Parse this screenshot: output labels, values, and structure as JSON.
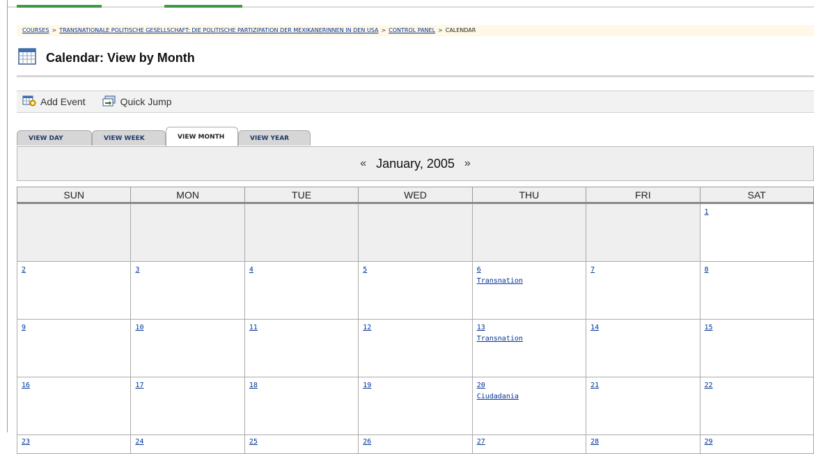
{
  "breadcrumb": {
    "items": [
      "COURSES",
      "TRANSNATIONALE POLITISCHE GESELLSCHAFT: DIE POLITISCHE PARTIZIPATION DER MEXIKANERINNEN IN DEN USA",
      "CONTROL PANEL"
    ],
    "current": "CALENDAR",
    "separator": ">"
  },
  "page": {
    "title": "Calendar: View by Month",
    "icon": "calendar-icon"
  },
  "actions": {
    "add_event": "Add Event",
    "quick_jump": "Quick Jump"
  },
  "tabs": [
    "VIEW DAY",
    "VIEW WEEK",
    "VIEW MONTH",
    "VIEW YEAR"
  ],
  "active_tab": "VIEW MONTH",
  "month": {
    "title": "January, 2005",
    "prev": "«",
    "next": "»"
  },
  "days_of_week": [
    "SUN",
    "MON",
    "TUE",
    "WED",
    "THU",
    "FRI",
    "SAT"
  ],
  "weeks": [
    [
      null,
      null,
      null,
      null,
      null,
      null,
      {
        "day": "1"
      }
    ],
    [
      {
        "day": "2"
      },
      {
        "day": "3"
      },
      {
        "day": "4"
      },
      {
        "day": "5"
      },
      {
        "day": "6",
        "event": "Transnation"
      },
      {
        "day": "7"
      },
      {
        "day": "8"
      }
    ],
    [
      {
        "day": "9"
      },
      {
        "day": "10"
      },
      {
        "day": "11"
      },
      {
        "day": "12"
      },
      {
        "day": "13",
        "event": "Transnation"
      },
      {
        "day": "14"
      },
      {
        "day": "15"
      }
    ],
    [
      {
        "day": "16"
      },
      {
        "day": "17"
      },
      {
        "day": "18"
      },
      {
        "day": "19"
      },
      {
        "day": "20",
        "event": "Ciudadania"
      },
      {
        "day": "21"
      },
      {
        "day": "22"
      }
    ],
    [
      {
        "day": "23"
      },
      {
        "day": "24"
      },
      {
        "day": "25"
      },
      {
        "day": "26"
      },
      {
        "day": "27"
      },
      {
        "day": "28"
      },
      {
        "day": "29"
      }
    ]
  ],
  "colors": {
    "accent_green": "#3e9a3e",
    "link": "#003399",
    "breadcrumb_bg": "#fff8e6",
    "header_bg": "#efefef"
  }
}
